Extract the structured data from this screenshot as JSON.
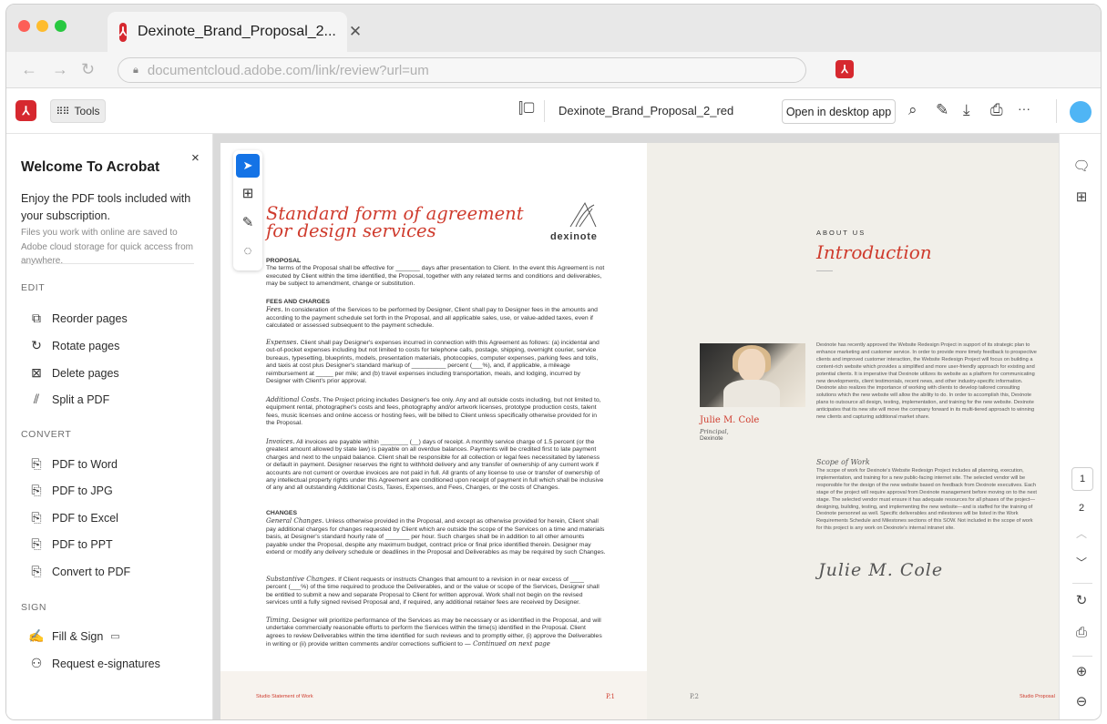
{
  "browser": {
    "tab_title": "Dexinote_Brand_Proposal_2...",
    "tab_close": "✕",
    "url": "documentcloud.adobe.com/link/review?url=um"
  },
  "toolbar": {
    "tools_label": "Tools",
    "doc_title": "Dexinote_Brand_Proposal_2_red",
    "open_desktop_label": "Open in desktop app",
    "more_label": "···"
  },
  "left_panel": {
    "title": "Welcome To Acrobat",
    "close": "×",
    "description": "Enjoy the PDF tools included with your subscription.",
    "subtext": "Files you work with online are saved to Adobe cloud storage for quick access from anywhere.",
    "sections": {
      "edit": "EDIT",
      "convert": "CONVERT",
      "sign": "SIGN"
    },
    "edit_items": [
      "Reorder pages",
      "Rotate pages",
      "Delete pages",
      "Split a PDF"
    ],
    "convert_items": [
      "PDF to Word",
      "PDF to JPG",
      "PDF to Excel",
      "PDF to PPT",
      "Convert to PDF"
    ],
    "sign_items": [
      "Fill & Sign",
      "Request e-signatures"
    ]
  },
  "document": {
    "agreement_title_line1": "Standard form of agreement",
    "agreement_title_line2": "for design services",
    "logo_text": "dexinote",
    "proposal_heading": "PROPOSAL",
    "proposal_text": "The terms of the Proposal shall be effective for _______ days after presentation to Client. In the event this Agreement is not executed by Client within the time identified, the Proposal, together with any related terms and conditions and deliverables, may be subject to amendment, change or substitution.",
    "fees_heading": "FEES AND CHARGES",
    "fees_label": "Fees.",
    "fees_text": " In consideration of the Services to be performed by Designer, Client shall pay to Designer fees in the amounts and according to the payment schedule set forth in the Proposal, and all applicable sales, use, or value-added taxes, even if calculated or assessed subsequent to the payment schedule.",
    "expenses_label": "Expenses.",
    "expenses_text": " Client shall pay Designer's expenses incurred in connection with this Agreement as follows: (a) incidental and out-of-pocket expenses including but not limited to costs for telephone calls, postage, shipping, overnight courier, service bureaus, typesetting, blueprints, models, presentation materials, photocopies, computer expenses, parking fees and tolls, and taxis at cost plus Designer's standard markup of __________ percent (___%), and, if applicable, a mileage reimbursement at _____ per mile; and (b) travel expenses including transportation, meals, and lodging, incurred by Designer with Client's prior approval.",
    "additional_label": "Additional Costs.",
    "additional_text": " The Project pricing includes Designer's fee only. Any and all outside costs including, but not limited to, equipment rental, photographer's costs and fees, photography and/or artwork licenses, prototype production costs, talent fees, music licenses and online access or hosting fees, will be billed to Client unless specifically otherwise provided for in the Proposal.",
    "invoices_label": "Invoices.",
    "invoices_text": " All invoices are payable within ________ (__) days of receipt. A monthly service charge of 1.5 percent (or the greatest amount allowed by state law) is payable on all overdue balances. Payments will be credited first to late payment charges and next to the unpaid balance. Client shall be responsible for all collection or legal fees necessitated by lateness or default in payment. Designer reserves the right to withhold delivery and any transfer of ownership of any current work if accounts are not current or overdue invoices are not paid in full. All grants of any license to use or transfer of ownership of any intellectual property rights under this Agreement are conditioned upon receipt of payment in full which shall be inclusive of any and all outstanding Additional Costs, Taxes, Expenses, and Fees, Charges, or the costs of Changes.",
    "changes_heading": "CHANGES",
    "general_label": "General Changes.",
    "general_text": " Unless otherwise provided in the Proposal, and except as otherwise provided for herein, Client shall pay additional charges for changes requested by Client which are outside the scope of the Services on a time and materials basis, at Designer's standard hourly rate of _______ per hour. Such charges shall be in addition to all other amounts payable under the Proposal, despite any maximum budget, contract price or final price identified therein. Designer may extend or modify any delivery schedule or deadlines in the Proposal and Deliverables as may be required by such Changes.",
    "substantive_label": "Substantive Changes.",
    "substantive_text": " If Client requests or instructs Changes that amount to a revision in or near excess of ____ percent (___%) of the time required to produce the Deliverables, and or the value or scope of the Services, Designer shall be entitled to submit a new and separate Proposal to Client for written approval. Work shall not begin on the revised services until a fully signed revised Proposal and, if required, any additional retainer fees are received by Designer.",
    "timing_label": "Timing.",
    "timing_text": " Designer will prioritize performance of the Services as may be necessary or as identified in the Proposal, and will undertake commercially reasonable efforts to perform the Services within the time(s) identified in the Proposal. Client agrees to review Deliverables within the time identified for such reviews and to promptly either, (i) approve the Deliverables in writing or (ii) provide written comments and/or corrections sufficient to",
    "continued": "— Continued on next page",
    "about_us": "ABOUT US",
    "intro_title": "Introduction",
    "person_name": "Julie M. Cole",
    "person_role": "Principal,",
    "person_company": "Dexinote",
    "intro_text": "Dexinote has recently approved the Website Redesign Project in support of its strategic plan to enhance marketing and customer service. In order to provide more timely feedback to prospective clients and improved customer interaction, the Website Redesign Project will focus on building a content-rich website which provides a simplified and more user-friendly approach for existing and potential clients. It is imperative that Dexinote utilizes its website as a platform for communicating new developments, client testimonials, recent news, and other industry-specific information. Dexinote also realizes the importance of working with clients to develop tailored consulting solutions which the new website will allow the ability to do. In order to accomplish this, Dexinote plans to outsource all design, testing, implementation, and training for the new website. Dexinote anticipates that its new site will move the company forward in its multi-tiered approach to winning new clients and capturing additional market share.",
    "scope_title": "Scope of Work",
    "scope_text": "The scope of work for Dexinote's Website Redesign Project includes all planning, execution, implementation, and training for a new public-facing internet site. The selected vendor will be responsible for the design of the new website based on feedback from Dexinote executives. Each stage of the project will require approval from Dexinote management before moving on to the next stage. The selected vendor must ensure it has adequate resources for all phases of the project—designing, building, testing, and implementing the new website—and is staffed for the training of Dexinote personnel as well. Specific deliverables and milestones will be listed in the Work Requirements Schedule and Milestones sections of this SOW. Not included in the scope of work for this project is any work on Dexinote's internal intranet site.",
    "signature": "Julie M. Cole",
    "footer_left_label": "Studio Statement of Work",
    "footer_left_page": "P.1",
    "footer_right_page": "P.2",
    "footer_right_label": "Studio Proposal"
  },
  "pager": {
    "current": "1",
    "next": "2"
  },
  "colors": {
    "accent_red": "#cf3b2d",
    "acrobat_red": "#d6282f",
    "selection_blue": "#1473e6",
    "avatar_blue": "#4fb5f5"
  }
}
